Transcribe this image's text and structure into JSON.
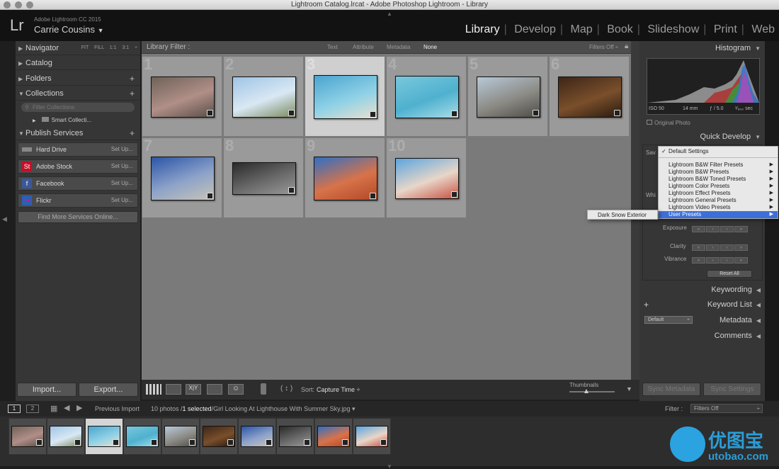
{
  "window": {
    "title": "Lightroom Catalog.lrcat - Adobe Photoshop Lightroom - Library"
  },
  "identity": {
    "logo": "Lr",
    "version": "Adobe Lightroom CC 2015",
    "user": "Carrie Cousins",
    "user_arrow": "▼"
  },
  "modules": [
    "Library",
    "Develop",
    "Map",
    "Book",
    "Slideshow",
    "Print",
    "Web"
  ],
  "left_panel": {
    "navigator": {
      "label": "Navigator",
      "zoom_options": [
        "FIT",
        "FILL",
        "1:1",
        "3:1"
      ]
    },
    "catalog": "Catalog",
    "folders": "Folders",
    "collections": "Collections",
    "collections_filter_placeholder": "Filter Collections",
    "smart_collections": "Smart Collecti...",
    "publish_services": "Publish Services",
    "services": [
      {
        "name": "Hard Drive",
        "setup": "Set Up...",
        "icon_color": "#888888",
        "icon": "hard-drive-icon"
      },
      {
        "name": "Adobe Stock",
        "setup": "Set Up...",
        "icon_color": "#c4102a",
        "icon_text": "St",
        "icon": "adobe-stock-icon"
      },
      {
        "name": "Facebook",
        "setup": "Set Up...",
        "icon_color": "#3b5998",
        "icon_text": "f",
        "icon": "facebook-icon"
      },
      {
        "name": "Flickr",
        "setup": "Set Up...",
        "icon_color": "#2d5fb4",
        "icon_text": "●●",
        "icon": "flickr-icon"
      }
    ],
    "find_more": "Find More Services Online...",
    "import_btn": "Import...",
    "export_btn": "Export..."
  },
  "filter_bar": {
    "label": "Library Filter :",
    "options": [
      "Text",
      "Attribute",
      "Metadata",
      "None"
    ],
    "active": "None",
    "filters_off": "Filters Off ÷"
  },
  "grid": {
    "selected_index": 3,
    "photos": [
      {
        "num": "1",
        "colors": [
          "#6f6258",
          "#b08f88",
          "#5a4e47"
        ]
      },
      {
        "num": "2",
        "colors": [
          "#9fc4e6",
          "#d9e8f3",
          "#7a8a60"
        ]
      },
      {
        "num": "3",
        "colors": [
          "#4aa4cf",
          "#8fd1e6",
          "#e9e1cf"
        ]
      },
      {
        "num": "4",
        "colors": [
          "#79c7dc",
          "#4fb1cf",
          "#a8dce8"
        ]
      },
      {
        "num": "5",
        "colors": [
          "#b7c9d9",
          "#8c8b85",
          "#4f4c47"
        ]
      },
      {
        "num": "6",
        "colors": [
          "#3d2618",
          "#7a4f2b",
          "#2a1a10"
        ]
      },
      {
        "num": "7",
        "colors": [
          "#2b55a8",
          "#8ea3c9",
          "#c7c4b7"
        ]
      },
      {
        "num": "8",
        "colors": [
          "#2a2a2a",
          "#6a6a6a",
          "#999999"
        ]
      },
      {
        "num": "9",
        "colors": [
          "#2f6fc4",
          "#d7734a",
          "#b34827"
        ]
      },
      {
        "num": "10",
        "colors": [
          "#5ba5e0",
          "#e8d6c8",
          "#c75243"
        ]
      }
    ]
  },
  "toolbar": {
    "sort_label": "Sort:",
    "sort_value": "Capture Time",
    "thumbnails_label": "Thumbnails"
  },
  "right_panel": {
    "histogram": "Histogram",
    "iso": "ISO 50",
    "focal": "14 mm",
    "aperture": "ƒ / 5.0",
    "shutter": "¹⁄₈₀₀ sec",
    "original_photo": "Original Photo",
    "quick_develop": "Quick Develop",
    "saved_preset_label": "Sav",
    "wb_label": "Whi",
    "exposure": "Exposure",
    "clarity": "Clarity",
    "vibrance": "Vibrance",
    "reset_all": "Reset All",
    "keywording": "Keywording",
    "keyword_list": "Keyword List",
    "metadata": "Metadata",
    "metadata_select": "Default",
    "comments": "Comments",
    "sync_metadata": "Sync Metadata",
    "sync_settings": "Sync Settings"
  },
  "preset_menu": {
    "items": [
      {
        "label": "Default Settings",
        "checked": true,
        "sub": false
      },
      {
        "label": "Lightroom B&W Filter Presets",
        "sub": true
      },
      {
        "label": "Lightroom B&W Presets",
        "sub": true
      },
      {
        "label": "Lightroom B&W Toned Presets",
        "sub": true
      },
      {
        "label": "Lightroom Color Presets",
        "sub": true
      },
      {
        "label": "Lightroom Effect Presets",
        "sub": true
      },
      {
        "label": "Lightroom General Presets",
        "sub": true
      },
      {
        "label": "Lightroom Video Presets",
        "sub": true
      },
      {
        "label": "User Presets",
        "sub": true,
        "highlighted": true
      }
    ],
    "submenu_item": "Dark Snow Exterior"
  },
  "filmstrip": {
    "pages": [
      "1",
      "2"
    ],
    "source": "Previous Import",
    "count_text": "10 photos /",
    "selected_text": "1 selected",
    "filename": "/Girl Looking At Lighthouse With Summer Sky.jpg ▾",
    "filter_label": "Filter :",
    "filter_value": "Filters Off"
  },
  "watermark": {
    "text": "优图宝",
    "url": "utobao.com"
  }
}
